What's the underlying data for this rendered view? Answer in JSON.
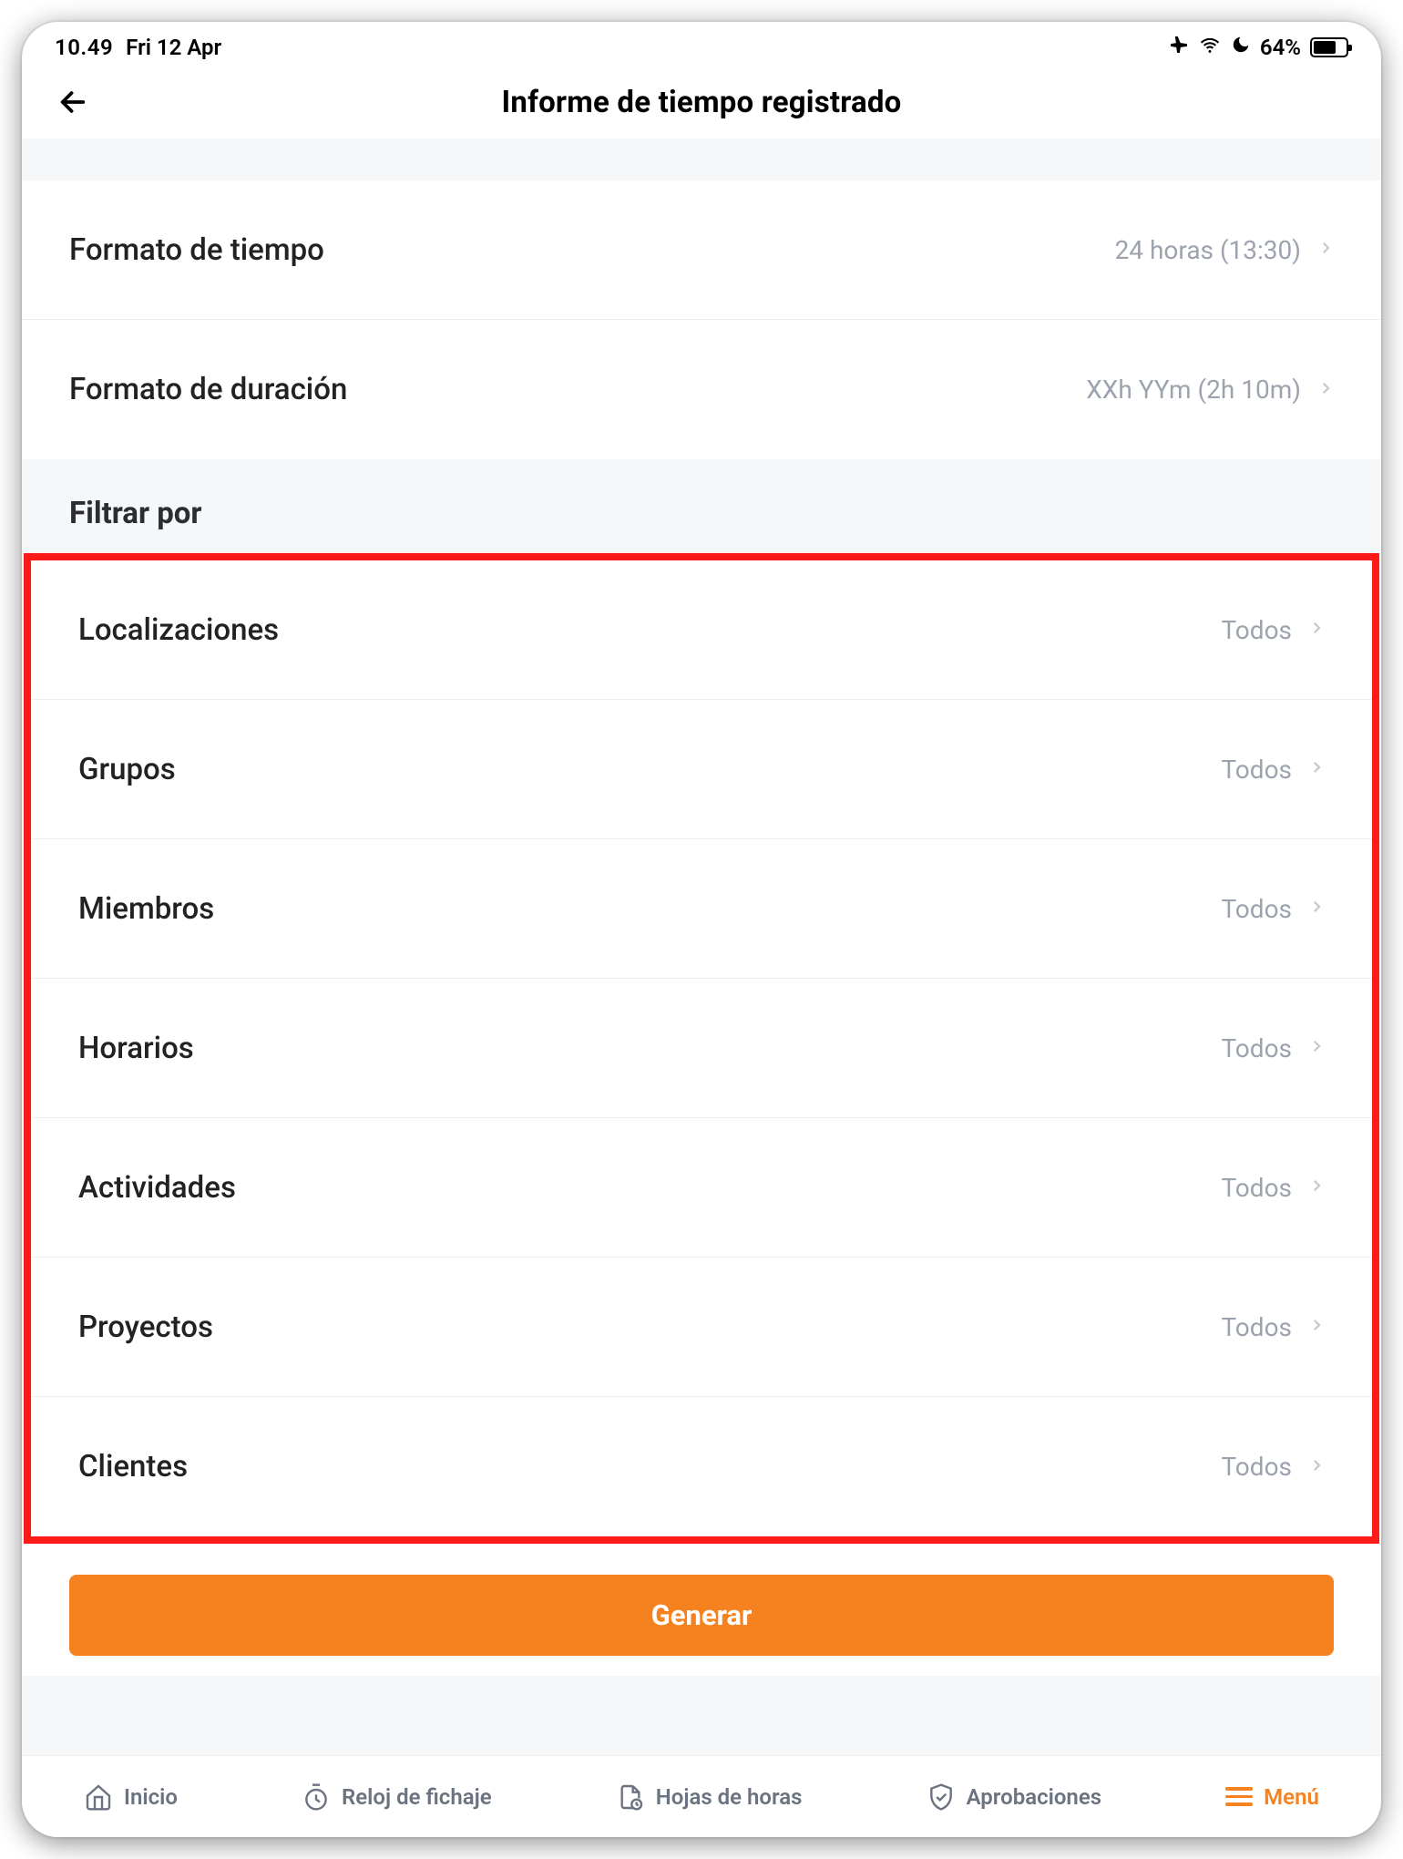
{
  "statusbar": {
    "time": "10.49",
    "date": "Fri 12 Apr",
    "battery_pct": "64%"
  },
  "navbar": {
    "title": "Informe de tiempo registrado"
  },
  "format_rows": [
    {
      "label": "Formato de tiempo",
      "value": "24 horas (13:30)"
    },
    {
      "label": "Formato de duración",
      "value": "XXh YYm (2h 10m)"
    }
  ],
  "filter_section_title": "Filtrar por",
  "filter_rows": [
    {
      "label": "Localizaciones",
      "value": "Todos"
    },
    {
      "label": "Grupos",
      "value": "Todos"
    },
    {
      "label": "Miembros",
      "value": "Todos"
    },
    {
      "label": "Horarios",
      "value": "Todos"
    },
    {
      "label": "Actividades",
      "value": "Todos"
    },
    {
      "label": "Proyectos",
      "value": "Todos"
    },
    {
      "label": "Clientes",
      "value": "Todos"
    }
  ],
  "generate_label": "Generar",
  "tabs": {
    "inicio": "Inicio",
    "reloj": "Reloj de fichaje",
    "hojas": "Hojas de horas",
    "aprob": "Aprobaciones",
    "menu": "Menú"
  }
}
